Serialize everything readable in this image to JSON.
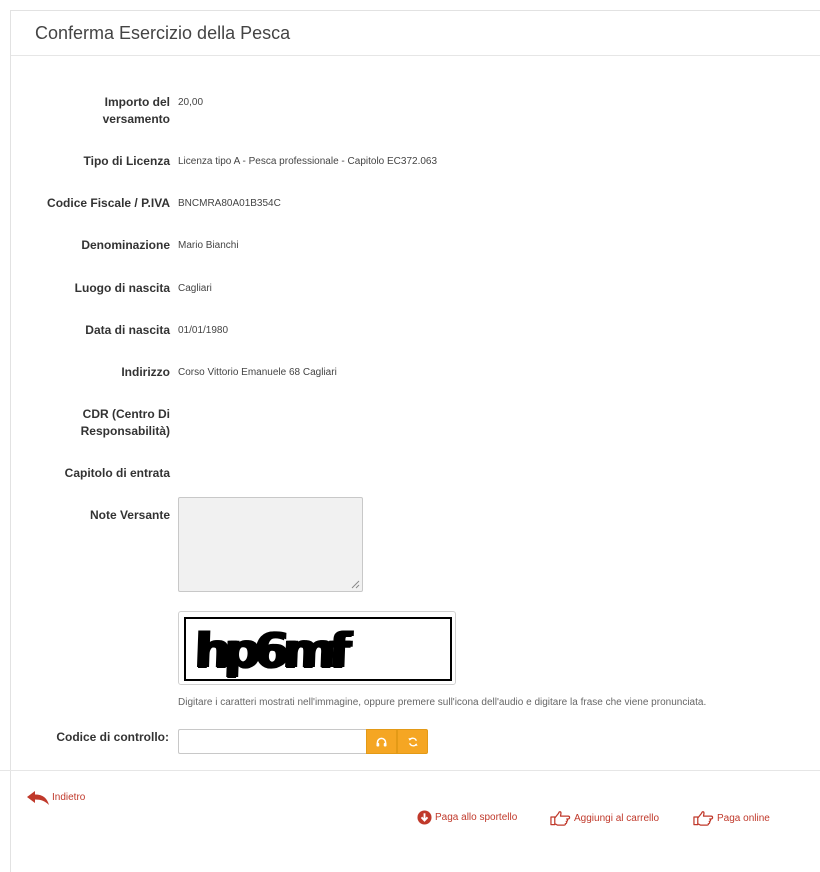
{
  "page": {
    "title": "Conferma Esercizio della Pesca"
  },
  "fields": [
    {
      "label": "Importo del versamento",
      "value": "20,00"
    },
    {
      "label": "Tipo di Licenza",
      "value": "Licenza tipo A - Pesca professionale - Capitolo EC372.063"
    },
    {
      "label": "Codice Fiscale / P.IVA",
      "value": "BNCMRA80A01B354C"
    },
    {
      "label": "Denominazione",
      "value": "Mario Bianchi"
    },
    {
      "label": "Luogo di nascita",
      "value": "Cagliari"
    },
    {
      "label": "Data di nascita",
      "value": "01/01/1980"
    },
    {
      "label": "Indirizzo",
      "value": "Corso Vittorio Emanuele 68 Cagliari"
    },
    {
      "label": "CDR (Centro Di Responsabilità)",
      "value": ""
    },
    {
      "label": "Capitolo di entrata",
      "value": ""
    },
    {
      "label": "Note Versante",
      "value": ""
    }
  ],
  "captcha": {
    "image_text": "hp6mf",
    "hint": "Digitare i caratteri mostrati nell'immagine, oppure premere sull'icona dell'audio e digitare la frase che viene pronunciata."
  },
  "control": {
    "label": "Codice di controllo:",
    "value": "",
    "audio_icon": "headphones-icon",
    "refresh_icon": "refresh-icon"
  },
  "footer": {
    "back_label": "Indietro",
    "actions": [
      {
        "label": "Paga allo sportello",
        "icon": "download-circle-icon"
      },
      {
        "label": "Aggiungi al carrello",
        "icon": "hand-pointing-icon"
      },
      {
        "label": "Paga online",
        "icon": "hand-pointing-icon"
      }
    ]
  },
  "colors": {
    "accent": "#f5a623",
    "link": "#c0392b"
  }
}
